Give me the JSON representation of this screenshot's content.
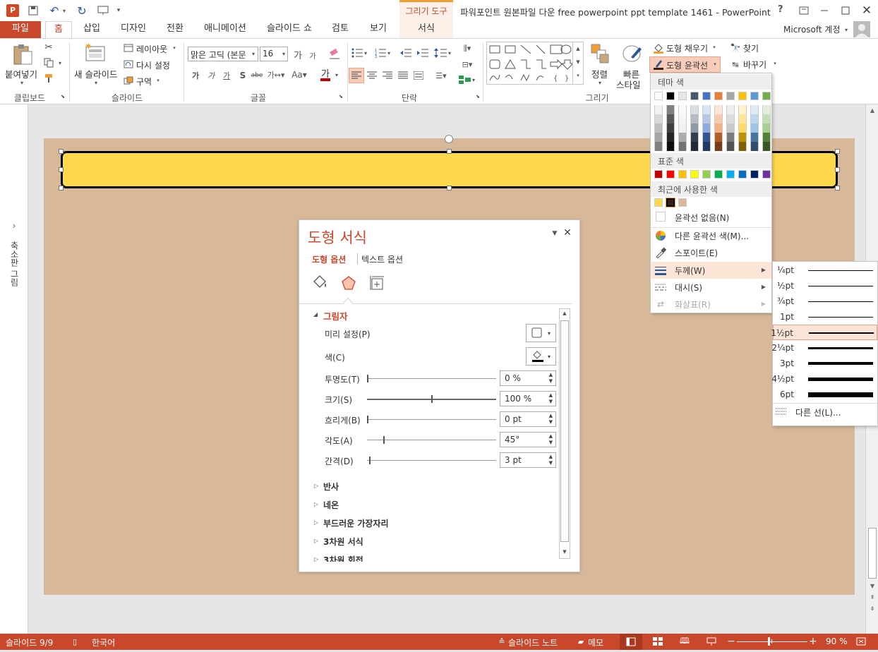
{
  "window": {
    "tool_context": "그리기 도구",
    "title": "파워포인트 원본파일 다운 free powerpoint ppt template 1461 - PowerPoint",
    "help": "?"
  },
  "tabs": [
    "파일",
    "홈",
    "삽입",
    "디자인",
    "전환",
    "애니메이션",
    "슬라이드 쇼",
    "검토",
    "보기",
    "서식"
  ],
  "account": "Microsoft 계정",
  "ribbon": {
    "clipboard": {
      "paste": "붙여넣기",
      "label": "클립보드"
    },
    "slides": {
      "new_slide": "새 슬라이드",
      "layout": "레이아웃",
      "reset": "다시 설정",
      "section": "구역",
      "label": "슬라이드"
    },
    "font": {
      "name": "맑은 고딕 (본문",
      "size": "16",
      "label": "글꼴"
    },
    "paragraph": {
      "label": "단락"
    },
    "drawing": {
      "arrange": "정렬",
      "quick_styles_1": "빠른",
      "quick_styles_2": "스타일",
      "label": "그리기"
    },
    "shape_fill": "도형 채우기",
    "shape_outline": "도형 윤곽선",
    "find": "찾기",
    "replace": "바꾸기"
  },
  "left_pane": {
    "label": "축소판 그림"
  },
  "format_pane": {
    "title": "도형 서식",
    "tab_shape": "도형 옵션",
    "tab_text": "텍스트 옵션",
    "section_shadow": "그림자",
    "preset": "미리 설정(P)",
    "color": "색(C)",
    "rows": [
      {
        "label": "투명도(T)",
        "value": "0 %",
        "level": 0
      },
      {
        "label": "크기(S)",
        "value": "100 %",
        "level": 0.5
      },
      {
        "label": "흐리게(B)",
        "value": "0 pt",
        "level": 0
      },
      {
        "label": "각도(A)",
        "value": "45°",
        "level": 0.13
      },
      {
        "label": "간격(D)",
        "value": "3 pt",
        "level": 0.02
      }
    ],
    "sections": [
      "반사",
      "네온",
      "부드러운 가장자리",
      "3차원 서식",
      "3차원 회전"
    ]
  },
  "outline_menu": {
    "theme_colors": "테마 색",
    "standard_colors": "표준 색",
    "recent_colors": "최근에 사용한 색",
    "no_outline": "윤곽선 없음(N)",
    "more_colors": "다른 윤곽선 색(M)...",
    "eyedropper": "스포이트(E)",
    "weight": "두께(W)",
    "dashes": "대시(S)",
    "arrows": "화살표(R)",
    "theme_top": [
      "#ffffff",
      "#000000",
      "#e7e6e6",
      "#44546a",
      "#4472c4",
      "#ed7d31",
      "#a5a5a5",
      "#ffc000",
      "#5b9bd5",
      "#70ad47"
    ],
    "standard": [
      "#c00000",
      "#ff0000",
      "#ffc000",
      "#ffff00",
      "#92d050",
      "#00b050",
      "#00b0f0",
      "#0070c0",
      "#002060",
      "#7030a0"
    ],
    "recent": [
      "#ffd84c",
      "#3b1f0e",
      "#d7b999"
    ]
  },
  "weight_menu": {
    "items": [
      {
        "label": "¼pt",
        "w": 0.25
      },
      {
        "label": "½pt",
        "w": 0.5
      },
      {
        "label": "¾pt",
        "w": 0.75
      },
      {
        "label": "1pt",
        "w": 1
      },
      {
        "label": "1½pt",
        "w": 1.5
      },
      {
        "label": "2¼pt",
        "w": 2.25
      },
      {
        "label": "3pt",
        "w": 3
      },
      {
        "label": "4½pt",
        "w": 4.5
      },
      {
        "label": "6pt",
        "w": 6
      }
    ],
    "selected": "1½pt",
    "more_lines": "다른 선(L)..."
  },
  "status": {
    "slide": "슬라이드 9/9",
    "language": "한국어",
    "notes": "슬라이드 노트",
    "comments": "메모",
    "zoom": "90 %"
  }
}
